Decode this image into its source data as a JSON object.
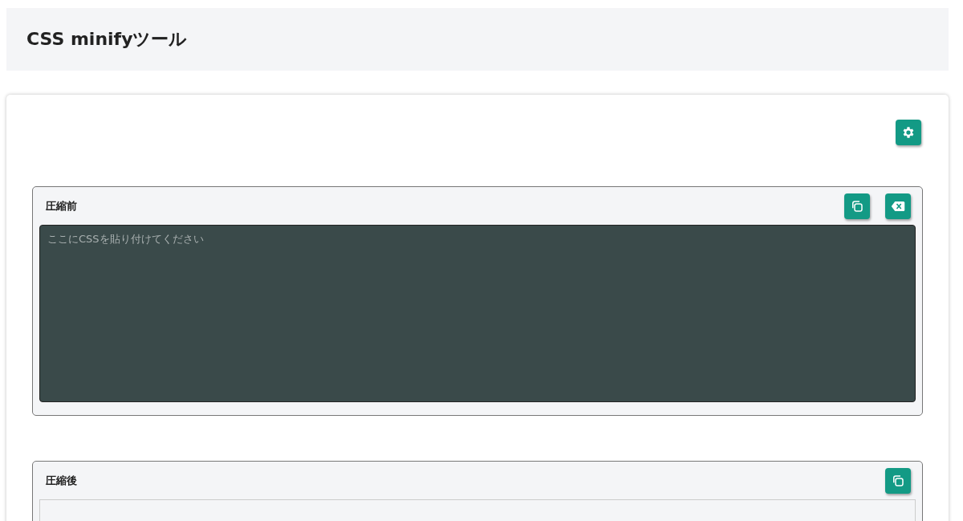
{
  "header": {
    "title": "CSS minifyツール"
  },
  "toolbar": {
    "buttons": [
      {
        "kind": "settings"
      }
    ]
  },
  "panels": [
    {
      "label": "圧縮前",
      "buttons": [
        {
          "kind": "copy"
        },
        {
          "kind": "clear"
        }
      ],
      "editor": {
        "kind": "input",
        "placeholder": "ここにCSSを貼り付けてください"
      }
    },
    {
      "label": "圧縮後",
      "buttons": [
        {
          "kind": "copy"
        }
      ],
      "editor": {
        "kind": "output"
      }
    }
  ]
}
